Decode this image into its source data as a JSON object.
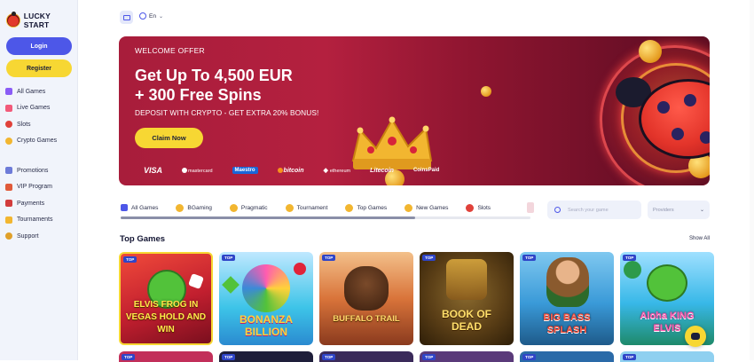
{
  "brand": {
    "name": "LUCKY START"
  },
  "auth": {
    "login_label": "Login",
    "register_label": "Register"
  },
  "sidebar": {
    "primary": [
      {
        "label": "All Games",
        "icon": "grid-icon",
        "color": "#8a5cf6"
      },
      {
        "label": "Live Games",
        "icon": "live-icon",
        "color": "#f25a7a"
      },
      {
        "label": "Slots",
        "icon": "cherry-icon",
        "color": "#e0413a"
      },
      {
        "label": "Crypto Games",
        "icon": "coin-icon",
        "color": "#f2b630"
      }
    ],
    "secondary": [
      {
        "label": "Promotions",
        "icon": "gift-icon",
        "color": "#6d7bd8"
      },
      {
        "label": "VIP Program",
        "icon": "crown-icon",
        "color": "#e05a3a"
      },
      {
        "label": "Payments",
        "icon": "wallet-icon",
        "color": "#d23c3c"
      },
      {
        "label": "Tournaments",
        "icon": "trophy-icon",
        "color": "#f2b630"
      },
      {
        "label": "Support",
        "icon": "support-icon",
        "color": "#e0a02a"
      }
    ]
  },
  "topbar": {
    "language": "En",
    "mail_icon": "mail-icon",
    "globe_icon": "globe-icon"
  },
  "hero": {
    "eyebrow": "WELCOME OFFER",
    "headline_1": "Get Up To 4,500 EUR",
    "headline_2": "+ 300 Free Spins",
    "subline": "DEPOSIT WITH CRYPTO - GET EXTRA 20% BONUS!",
    "cta": "Claim Now",
    "payment_methods": [
      "VISA",
      "mastercard",
      "Maestro",
      "bitcoin",
      "ethereum",
      "Litecoin",
      "CoinsPaid"
    ]
  },
  "categories": [
    {
      "label": "All Games",
      "color": "#4d57e8"
    },
    {
      "label": "BGaming",
      "color": "#f2b630"
    },
    {
      "label": "Pragmatic",
      "color": "#f2b630"
    },
    {
      "label": "Tournament",
      "color": "#f2b630"
    },
    {
      "label": "Top Games",
      "color": "#f2b630"
    },
    {
      "label": "New Games",
      "color": "#f2b630"
    },
    {
      "label": "Slots",
      "color": "#e0413a"
    }
  ],
  "search": {
    "placeholder": "Search your game"
  },
  "providers": {
    "label": "Providers"
  },
  "top_games": {
    "title": "Top Games",
    "show_all": "Show All",
    "badge": "TOP",
    "games": [
      {
        "title": "ELVIS FROG IN VEGAS HOLD AND WIN",
        "bg": "#c21f2f",
        "accent": "#52c23a",
        "text_color": "#ffe94a"
      },
      {
        "title": "BONANZA BILLION",
        "bg": "#3dc4e8",
        "accent": "#ff5cb0",
        "text_color": "#ffd23a"
      },
      {
        "title": "BUFFALO TRAIL",
        "bg": "#d9743a",
        "accent": "#6b3a1e",
        "text_color": "#ffd86a"
      },
      {
        "title": "BOOK OF DEAD",
        "bg": "#6b4a1e",
        "accent": "#e8b443",
        "text_color": "#ffdf6a"
      },
      {
        "title": "BIG BASS SPLASH",
        "bg": "#3a9ad8",
        "accent": "#2d6a2a",
        "text_color": "#ff4d3a"
      },
      {
        "title": "Aloha KING ELVIS",
        "bg": "#38b8e8",
        "accent": "#ff8a2a",
        "text_color": "#ff5ab0"
      }
    ]
  }
}
